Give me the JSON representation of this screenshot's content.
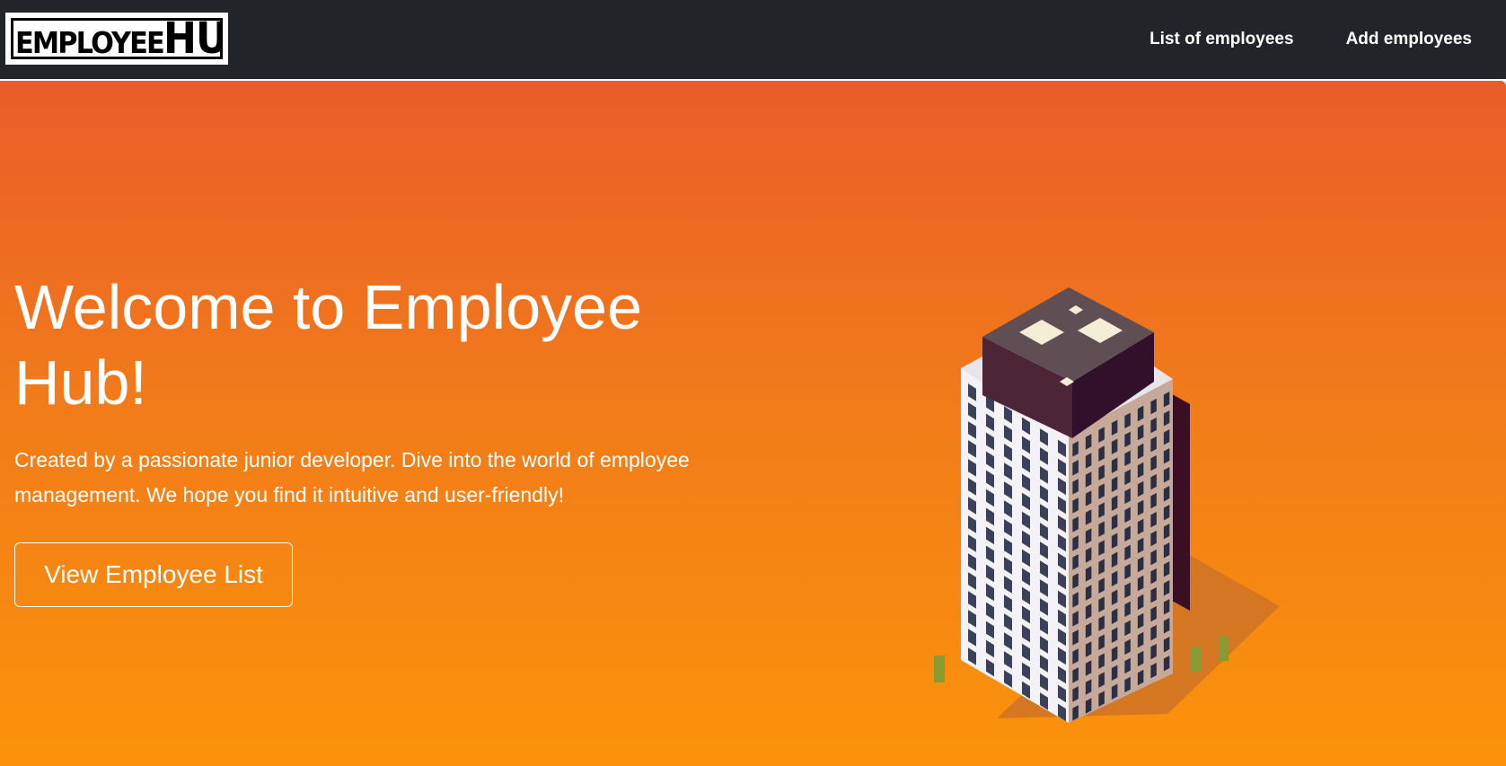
{
  "navbar": {
    "logo_text_a": "EMPLOYEE",
    "logo_text_b": "HUB",
    "links": [
      {
        "label": "List of employees"
      },
      {
        "label": "Add employees"
      }
    ]
  },
  "hero": {
    "title": "Welcome to Employee Hub!",
    "description": "Created by a passionate junior developer. Dive into the world of employee management. We hope you find it intuitive and user-friendly!",
    "button_label": "View Employee List",
    "illustration": "office-building-illustration"
  },
  "colors": {
    "navbar_bg": "#212529",
    "hero_gradient_top": "#ea5c29",
    "hero_gradient_bottom": "#fb930a",
    "text": "#ffffff"
  }
}
